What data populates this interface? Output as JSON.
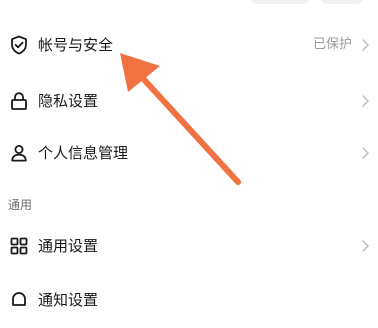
{
  "settings": {
    "rows": [
      {
        "label": "帐号与安全",
        "value": "已保护",
        "icon": "shield-check-icon"
      },
      {
        "label": "隐私设置",
        "value": "",
        "icon": "lock-icon"
      },
      {
        "label": "个人信息管理",
        "value": "",
        "icon": "person-icon"
      }
    ],
    "section_general": "通用",
    "general_rows": [
      {
        "label": "通用设置",
        "value": "",
        "icon": "grid-icon"
      },
      {
        "label": "通知设置",
        "value": "",
        "icon": "bell-icon"
      }
    ]
  },
  "annotation": {
    "arrow_color": "#f07242"
  }
}
